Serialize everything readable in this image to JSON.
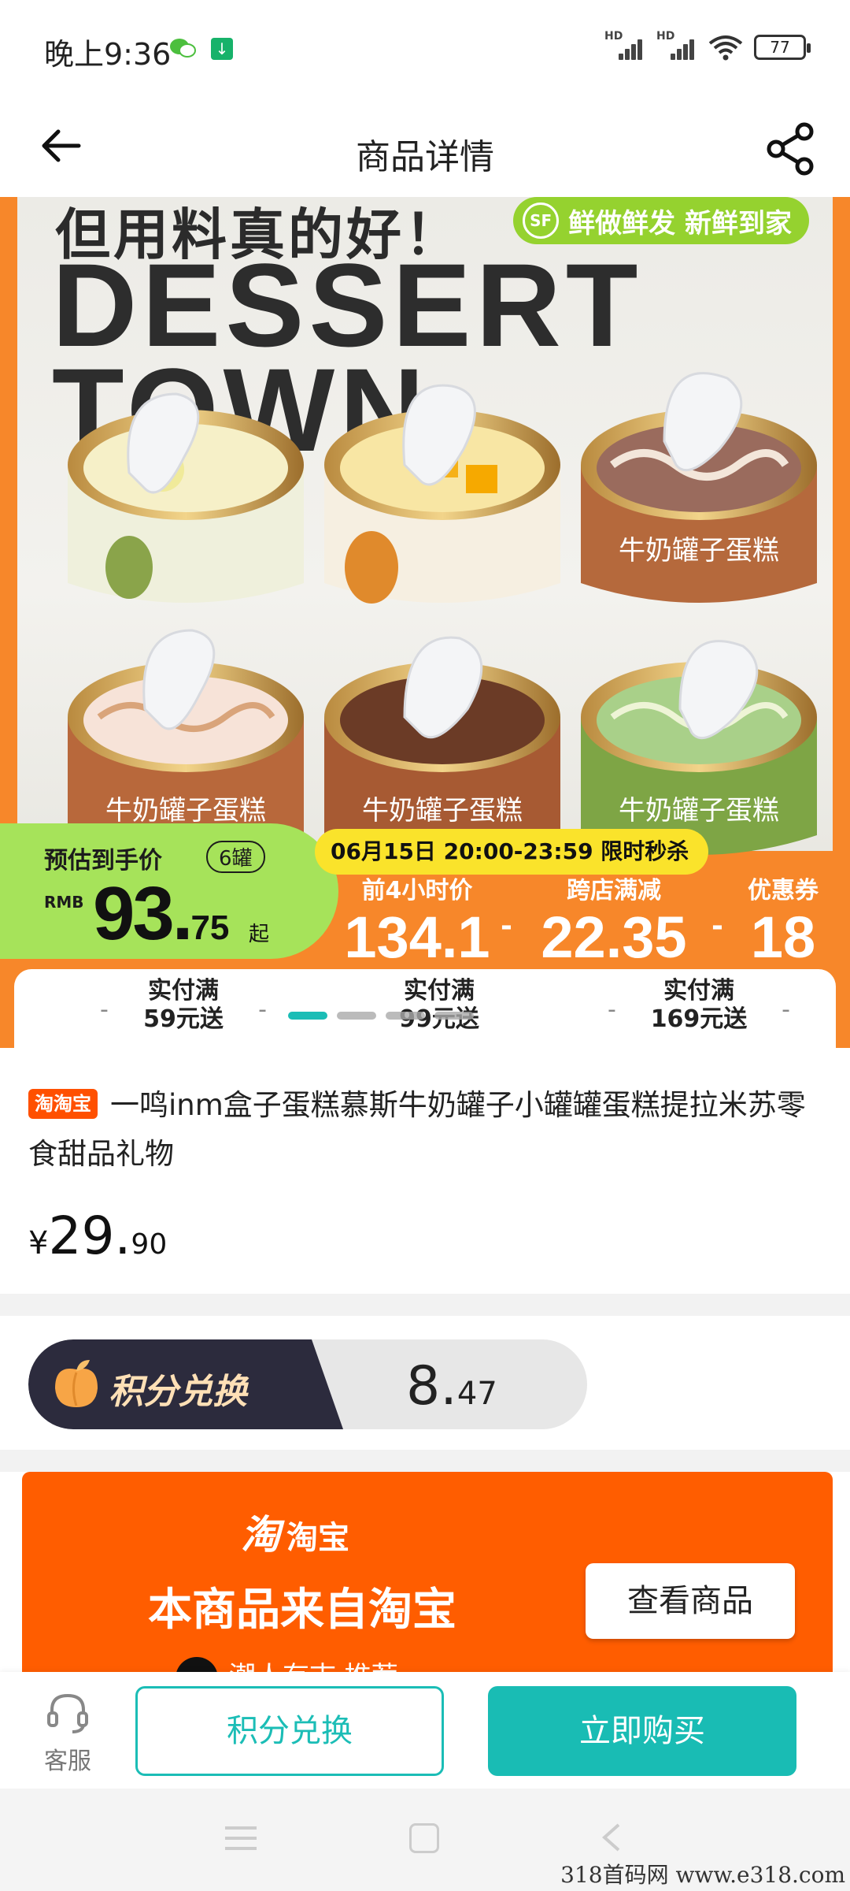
{
  "status_bar": {
    "time": "晚上9:36",
    "battery": "77",
    "network_1": "HD",
    "network_2": "HD"
  },
  "header": {
    "title": "商品详情"
  },
  "banner": {
    "slogan": "但用料真的好！",
    "headline_1": "DESSERT",
    "headline_2": "TOWN",
    "delivery_tag": "鲜做鲜发 新鲜到家",
    "delivery_logo": "SF",
    "can_label": "牛奶罐子蛋糕",
    "est_label": "预估到手价",
    "qty_tag": "6罐",
    "currency_label": "RMB",
    "est_price_int": "93.",
    "est_price_dec": "75",
    "est_price_suffix": "起",
    "flash_sale": "06月15日 20:00-23:59 限时秒杀",
    "deals": [
      {
        "label": "前4小时价",
        "value": "134.1"
      },
      {
        "label": "跨店满减",
        "value": "22.35"
      },
      {
        "label": "优惠券",
        "value": "18"
      }
    ],
    "deal_separator": "-",
    "coupons": [
      {
        "line1": "实付满",
        "line2": "59元送"
      },
      {
        "line1": "实付满",
        "line2": "99元送"
      },
      {
        "line1": "实付满",
        "line2": "169元送"
      }
    ],
    "active_slide_index": 0,
    "slide_count": 4
  },
  "product": {
    "source_tag": "淘淘宝",
    "title": "一鸣inm盒子蛋糕慕斯牛奶罐子小罐罐蛋糕提拉米苏零食甜品礼物",
    "price_currency": "¥",
    "price_int": "29.",
    "price_dec": "90"
  },
  "points": {
    "label": "积分兑换",
    "value_int": "8.",
    "value_dec": "47"
  },
  "taobao_card": {
    "logo_glyph": "淘",
    "logo_text": "淘宝",
    "message": "本商品来自淘宝",
    "view_button": "查看商品",
    "recommend_text": "潮人有志 推荐"
  },
  "action_bar": {
    "service_label": "客服",
    "points_button": "积分兑换",
    "buy_button": "立即购买"
  },
  "watermark": "318首码网 www.e318.com",
  "colors": {
    "accent": "#19bcb4",
    "taobao_orange": "#ff5d00",
    "banner_orange": "#f7872a",
    "price_green": "#a6e35a",
    "flash_yellow": "#fae32b"
  }
}
